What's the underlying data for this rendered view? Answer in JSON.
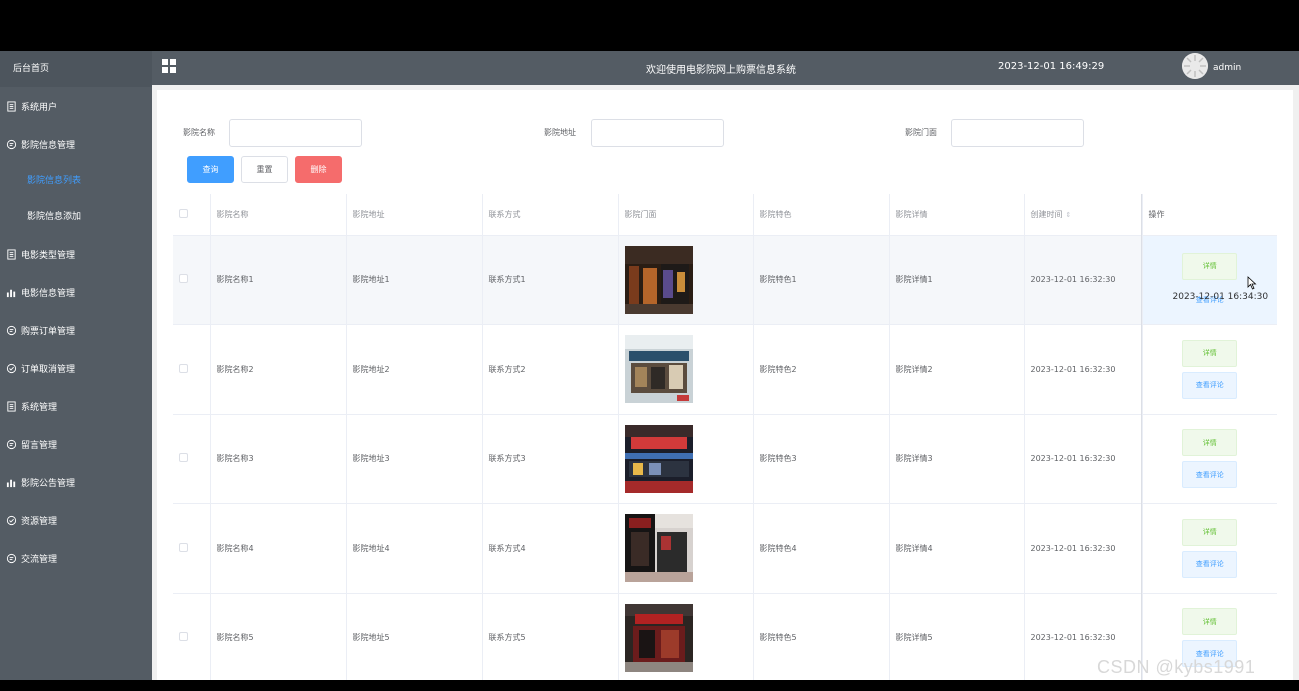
{
  "sidebar": {
    "home": "后台首页",
    "items": [
      {
        "label": "系统用户",
        "icon": "doc-icon"
      },
      {
        "label": "影院信息管理",
        "icon": "chat-icon",
        "expanded": true,
        "children": [
          {
            "label": "影院信息列表",
            "active": true
          },
          {
            "label": "影院信息添加",
            "active": false
          }
        ]
      },
      {
        "label": "电影类型管理",
        "icon": "doc-icon"
      },
      {
        "label": "电影信息管理",
        "icon": "bar-chart-icon"
      },
      {
        "label": "购票订单管理",
        "icon": "chat-icon"
      },
      {
        "label": "订单取消管理",
        "icon": "check-circle-icon"
      },
      {
        "label": "系统管理",
        "icon": "doc-icon"
      },
      {
        "label": "留言管理",
        "icon": "chat-icon"
      },
      {
        "label": "影院公告管理",
        "icon": "bar-chart-icon"
      },
      {
        "label": "资源管理",
        "icon": "check-circle-icon"
      },
      {
        "label": "交流管理",
        "icon": "chat-icon"
      }
    ]
  },
  "header": {
    "title": "欢迎使用电影院网上购票信息系统",
    "datetime": "2023-12-01 16:49:29",
    "username": "admin"
  },
  "search": {
    "name_label": "影院名称",
    "address_label": "影院地址",
    "storefront_label": "影院门面",
    "name_value": "",
    "address_value": "",
    "storefront_value": ""
  },
  "buttons": {
    "query": "查询",
    "reset": "重置",
    "delete": "删除"
  },
  "table": {
    "headers": [
      "影院名称",
      "影院地址",
      "联系方式",
      "影院门面",
      "影院特色",
      "影院详情",
      "创建时间",
      "操作"
    ],
    "detail_label": "详情",
    "comment_label": "查看评论",
    "hover_tooltip": "2023-12-01 16:34:30",
    "rows": [
      {
        "name": "影院名称1",
        "address": "影院地址1",
        "contact": "联系方式1",
        "feature": "影院特色1",
        "detail": "影院详情1",
        "created": "2023-12-01 16:32:30"
      },
      {
        "name": "影院名称2",
        "address": "影院地址2",
        "contact": "联系方式2",
        "feature": "影院特色2",
        "detail": "影院详情2",
        "created": "2023-12-01 16:32:30"
      },
      {
        "name": "影院名称3",
        "address": "影院地址3",
        "contact": "联系方式3",
        "feature": "影院特色3",
        "detail": "影院详情3",
        "created": "2023-12-01 16:32:30"
      },
      {
        "name": "影院名称4",
        "address": "影院地址4",
        "contact": "联系方式4",
        "feature": "影院特色4",
        "detail": "影院详情4",
        "created": "2023-12-01 16:32:30"
      },
      {
        "name": "影院名称5",
        "address": "影院地址5",
        "contact": "联系方式5",
        "feature": "影院特色5",
        "detail": "影院详情5",
        "created": "2023-12-01 16:32:30"
      }
    ]
  },
  "watermark": "CSDN @kybs1991",
  "colors": {
    "sidebar_bg": "#545c64",
    "primary": "#409eff",
    "danger": "#f56c6c",
    "success": "#67c23a"
  }
}
